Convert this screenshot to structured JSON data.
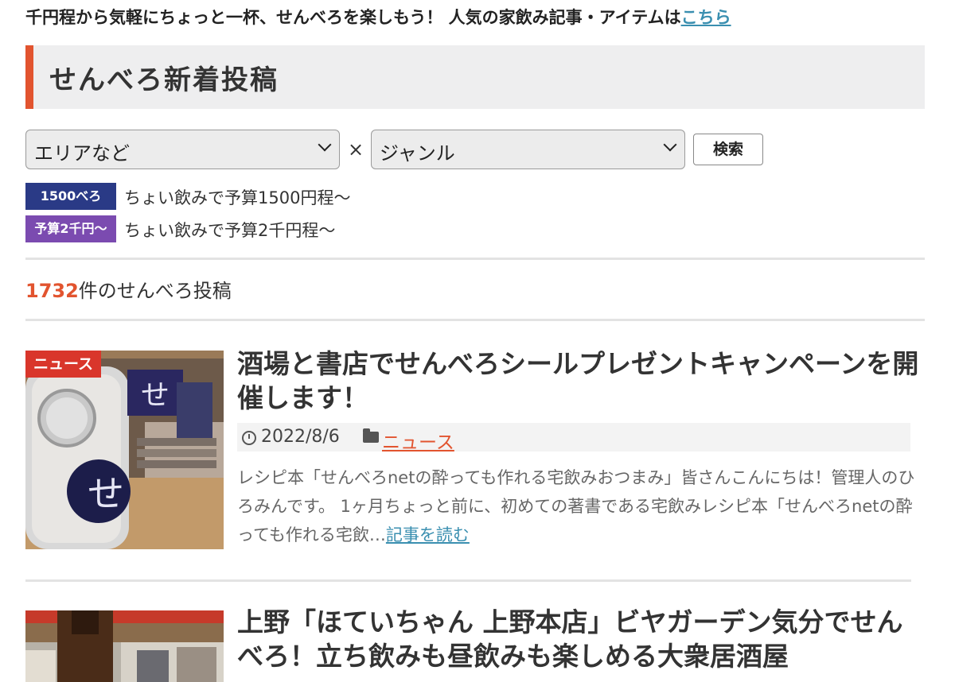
{
  "notice": {
    "text": "千円程から気軽にちょっと一杯、せんべろを楽しもう！ 人気の家飲み記事・アイテムは",
    "link": "こちら"
  },
  "section_title": "せんべろ新着投稿",
  "filters": {
    "area_value": "エリアなど",
    "times": "×",
    "genre_value": "ジャンル",
    "search_label": "検索"
  },
  "tags": [
    {
      "badge": "1500べろ",
      "desc": "ちょい飲みで予算1500円程〜",
      "color": "#2a3a86"
    },
    {
      "badge": "予算2千円〜",
      "desc": "ちょい飲みで予算2千円程〜",
      "color": "#7b4bb0"
    }
  ],
  "count": {
    "number": "1732",
    "suffix": "件のせんべろ投稿"
  },
  "posts": [
    {
      "category_badge": "ニュース",
      "title": "酒場と書店でせんべろシールプレゼントキャンペーンを開催します！",
      "date": "2022/8/6",
      "category": "ニュース",
      "excerpt": "レシピ本「せんべろnetの酔っても作れる宅飲みおつまみ」皆さんこんにちは！管理人のひろみんです。 1ヶ月ちょっと前に、初めての著書である宅飲みレシピ本「せんべろnetの酔っても作れる宅飲…",
      "read_more": "記事を読む"
    },
    {
      "title": "上野「ほていちゃん 上野本店」ビヤガーデン気分でせんべろ！立ち飲みも昼飲みも楽しめる大衆居酒屋"
    }
  ]
}
